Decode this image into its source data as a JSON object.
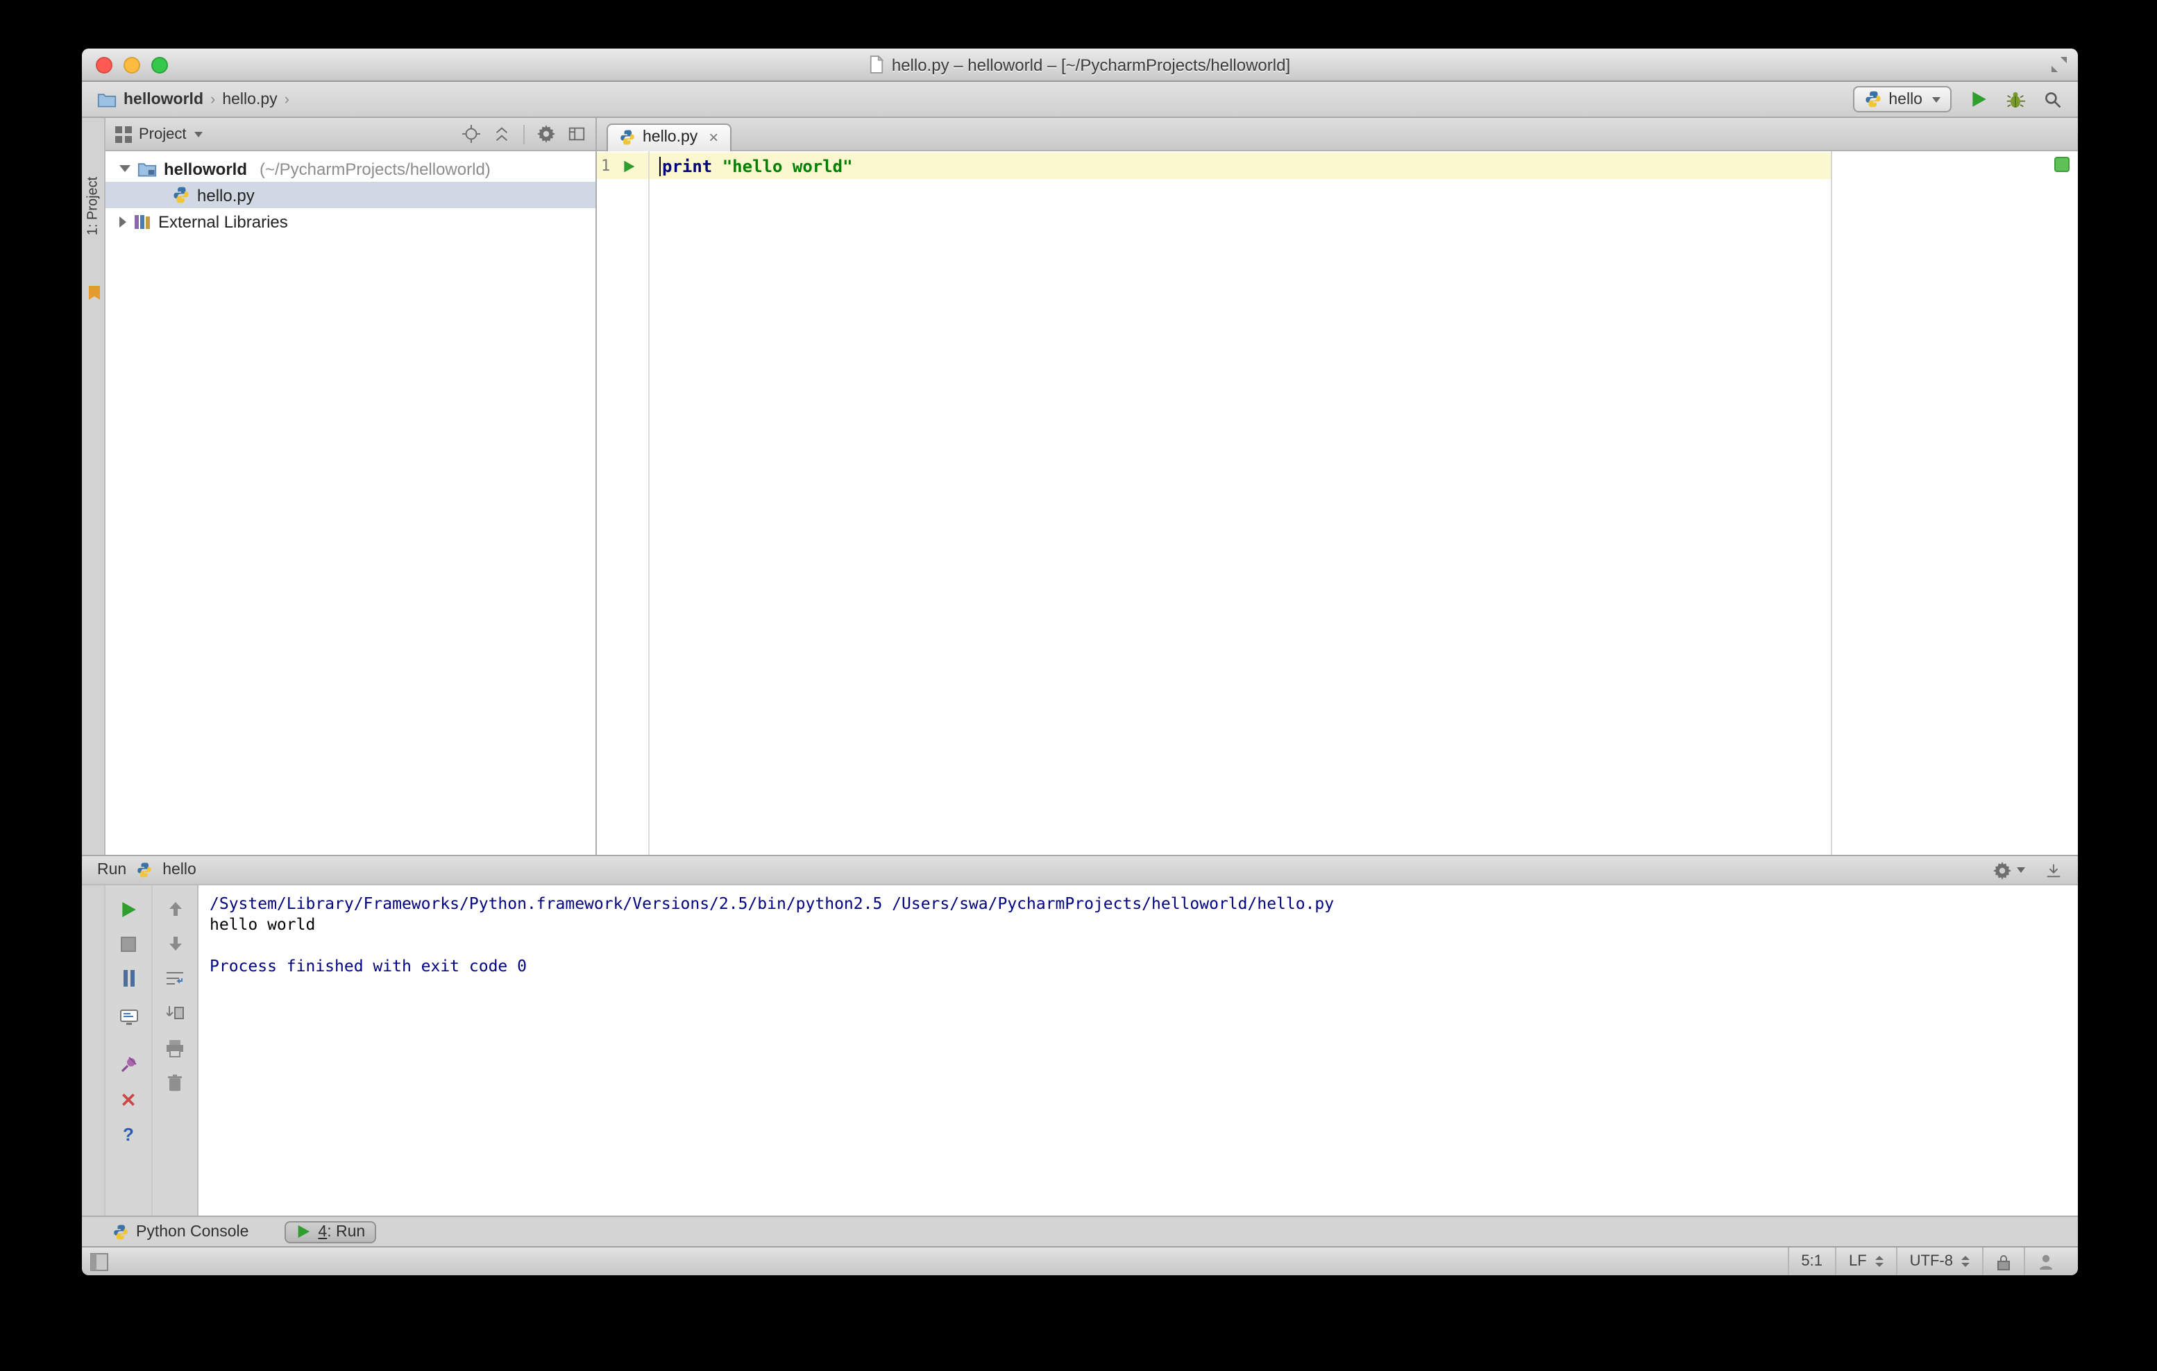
{
  "titlebar": {
    "title": "hello.py – helloworld – [~/PycharmProjects/helloworld]"
  },
  "navbar": {
    "crumb1": "helloworld",
    "crumb2": "hello.py",
    "separator": "›",
    "run_config": "hello"
  },
  "tool_stripe": {
    "project_button": "1: Project"
  },
  "project_panel": {
    "header_label": "Project",
    "root_name": "helloworld",
    "root_path": "(~/PycharmProjects/helloworld)",
    "file_name": "hello.py",
    "external_libraries": "External Libraries"
  },
  "editor": {
    "tab_label": "hello.py",
    "close_glyph": "×",
    "line_number": "1",
    "code": {
      "keyword": "print",
      "string": "\"hello world\""
    }
  },
  "run_panel": {
    "title": "Run",
    "config_name": "hello",
    "help_glyph": "?",
    "console_lines": [
      "/System/Library/Frameworks/Python.framework/Versions/2.5/bin/python2.5 /Users/swa/PycharmProjects/helloworld/hello.py",
      "hello world",
      "",
      "Process finished with exit code 0"
    ]
  },
  "bottom_bar": {
    "python_console_label": "Python Console",
    "run_tab_mnemonic": "4",
    "run_tab_label": ": Run"
  },
  "status_bar": {
    "caret_position": "5:1",
    "line_separator": "LF",
    "encoding": "UTF-8"
  },
  "colors": {
    "keyword_blue": "#000080",
    "string_green": "#008000",
    "console_system_blue": "#000080",
    "run_green": "#2f9e2f",
    "current_line_bg": "#fbf7cf",
    "selection_bg": "#d0d9e3",
    "indicator_green": "#5fc254",
    "error_red": "#d04444"
  }
}
